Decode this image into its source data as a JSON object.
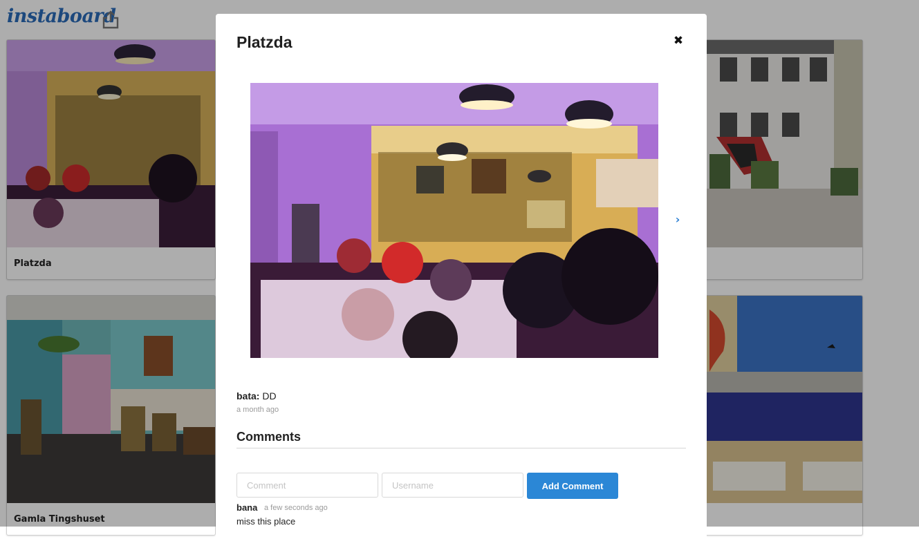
{
  "app": {
    "logo": "instaboard"
  },
  "board": {
    "cards": [
      {
        "caption": "Platzda",
        "image": "cafe-interior-purple-photo"
      },
      {
        "caption": "",
        "image": "building-facade-graffiti-photo"
      },
      {
        "caption": "Gamla Tingshuset",
        "image": "teal-cafe-interior-photo"
      },
      {
        "caption": "",
        "image": "zureich-banner-building-photo"
      }
    ]
  },
  "modal": {
    "title": "Platzda",
    "close_icon": "close-icon",
    "next_icon": "chevron-right-icon",
    "post": {
      "user": "bata:",
      "text": "DD",
      "time": "a month ago"
    },
    "comments_heading": "Comments",
    "form": {
      "comment_placeholder": "Comment",
      "username_placeholder": "Username",
      "submit_label": "Add Comment"
    },
    "comments": [
      {
        "user": "bana",
        "time": "a few seconds ago",
        "text": "miss this place"
      }
    ]
  },
  "colors": {
    "brand": "#2a6bb8",
    "accent": "#2b87d6",
    "overlay": "rgba(0,0,0,0.32)"
  }
}
